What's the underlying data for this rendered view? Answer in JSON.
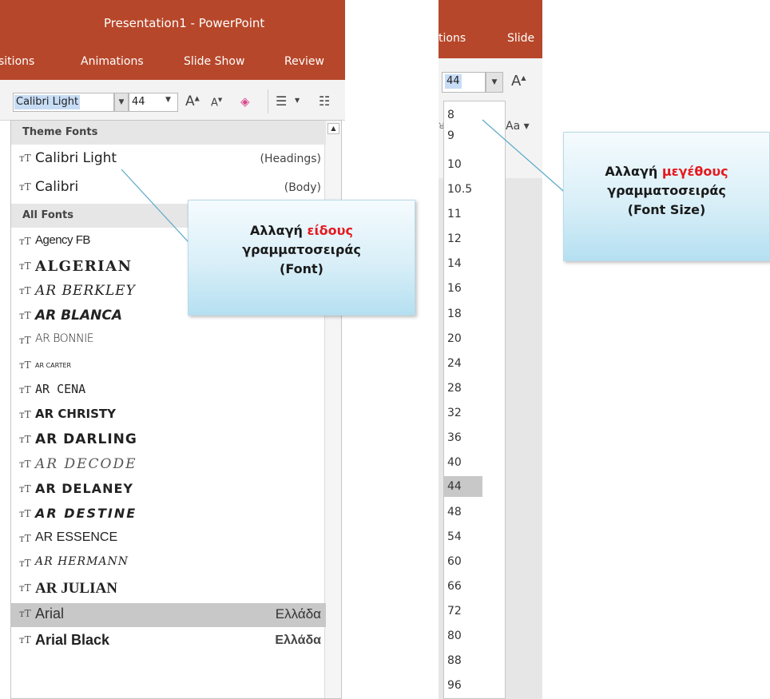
{
  "left": {
    "window_title": "Presentation1 - PowerPoint",
    "tabs": [
      "sitions",
      "Animations",
      "Slide Show",
      "Review"
    ],
    "font_name": "Calibri Light",
    "font_size": "44",
    "dropdown": {
      "theme_header": "Theme Fonts",
      "theme_fonts": [
        {
          "name": "Calibri Light",
          "hint": "(Headings)"
        },
        {
          "name": "Calibri",
          "hint": "(Body)"
        }
      ],
      "all_header": "All Fonts",
      "all_fonts": [
        {
          "name": "Agency FB",
          "hint": ""
        },
        {
          "name": "ALGERIAN",
          "hint": ""
        },
        {
          "name": "AR BERKLEY",
          "hint": ""
        },
        {
          "name": "AR BLANCA",
          "hint": ""
        },
        {
          "name": "AR BONNIE",
          "hint": ""
        },
        {
          "name": "AR CARTER",
          "hint": ""
        },
        {
          "name": "AR CENA",
          "hint": ""
        },
        {
          "name": "AR CHRISTY",
          "hint": ""
        },
        {
          "name": "AR DARLING",
          "hint": ""
        },
        {
          "name": "AR DECODE",
          "hint": ""
        },
        {
          "name": "AR DELANEY",
          "hint": ""
        },
        {
          "name": "AR DESTINE",
          "hint": ""
        },
        {
          "name": "AR ESSENCE",
          "hint": ""
        },
        {
          "name": "AR HERMANN",
          "hint": ""
        },
        {
          "name": "AR JULIAN",
          "hint": ""
        },
        {
          "name": "Arial",
          "hint": "Ελλάδα"
        },
        {
          "name": "Arial Black",
          "hint": "Ελλάδα"
        }
      ],
      "selected_font": "Arial"
    }
  },
  "right": {
    "tabs": [
      "tions",
      "Slide"
    ],
    "font_size": "44",
    "change_case_label": "Aa",
    "sizes": [
      "8",
      "9",
      "10",
      "10.5",
      "11",
      "12",
      "14",
      "16",
      "18",
      "20",
      "24",
      "28",
      "32",
      "36",
      "40",
      "44",
      "48",
      "54",
      "60",
      "66",
      "72",
      "80",
      "88",
      "96"
    ],
    "selected_size": "44",
    "more_indicator": "...."
  },
  "callout_font": {
    "line1_prefix": "Αλλαγή",
    "line1_highlight": "είδους",
    "line2": "γραμματοσειράς",
    "line3": "(Font)"
  },
  "callout_size": {
    "line1_prefix": "Αλλαγή",
    "line1_highlight": "μεγέθους",
    "line2": "γραμματοσειράς",
    "line3": "(Font Size)"
  },
  "colors": {
    "ribbon_accent": "#b7472a",
    "highlight_red": "#e5181e",
    "selection": "#c8c8c8"
  }
}
